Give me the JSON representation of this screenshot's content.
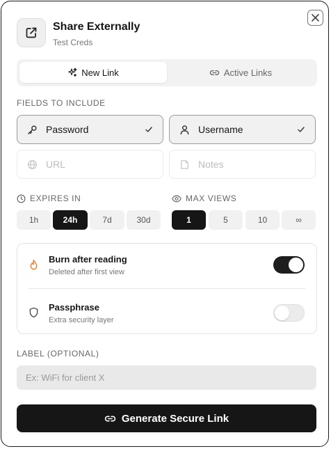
{
  "header": {
    "title": "Share Externally",
    "subtitle": "Test Creds",
    "icon": "external-link-icon"
  },
  "close_icon": "close-icon",
  "tabs": [
    {
      "label": "New Link",
      "icon": "sparkles-icon",
      "active": true
    },
    {
      "label": "Active Links",
      "icon": "link-icon",
      "active": false
    }
  ],
  "fields": {
    "label": "FIELDS TO INCLUDE",
    "items": [
      {
        "label": "Password",
        "icon": "key-icon",
        "selected": true
      },
      {
        "label": "Username",
        "icon": "user-icon",
        "selected": true
      },
      {
        "label": "URL",
        "icon": "globe-icon",
        "selected": false
      },
      {
        "label": "Notes",
        "icon": "note-icon",
        "selected": false
      }
    ]
  },
  "expires": {
    "label": "EXPIRES IN",
    "icon": "clock-icon",
    "options": [
      "1h",
      "24h",
      "7d",
      "30d"
    ],
    "selected": "24h"
  },
  "max_views": {
    "label": "MAX VIEWS",
    "icon": "eye-icon",
    "options": [
      "1",
      "5",
      "10",
      "∞"
    ],
    "selected": "1"
  },
  "options": {
    "burn": {
      "title": "Burn after reading",
      "subtitle": "Deleted after first view",
      "enabled": true,
      "icon": "flame-icon"
    },
    "passphrase": {
      "title": "Passphrase",
      "subtitle": "Extra security layer",
      "enabled": false,
      "icon": "shield-icon"
    }
  },
  "label_field": {
    "label": "LABEL (OPTIONAL)",
    "placeholder": "Ex: WiFi for client X",
    "value": ""
  },
  "generate": {
    "label": "Generate Secure Link",
    "icon": "link-icon"
  },
  "colors": {
    "accent": "#161616",
    "burn_icon": "#e8762b",
    "selected_field_bg": "#f1f1f1"
  }
}
